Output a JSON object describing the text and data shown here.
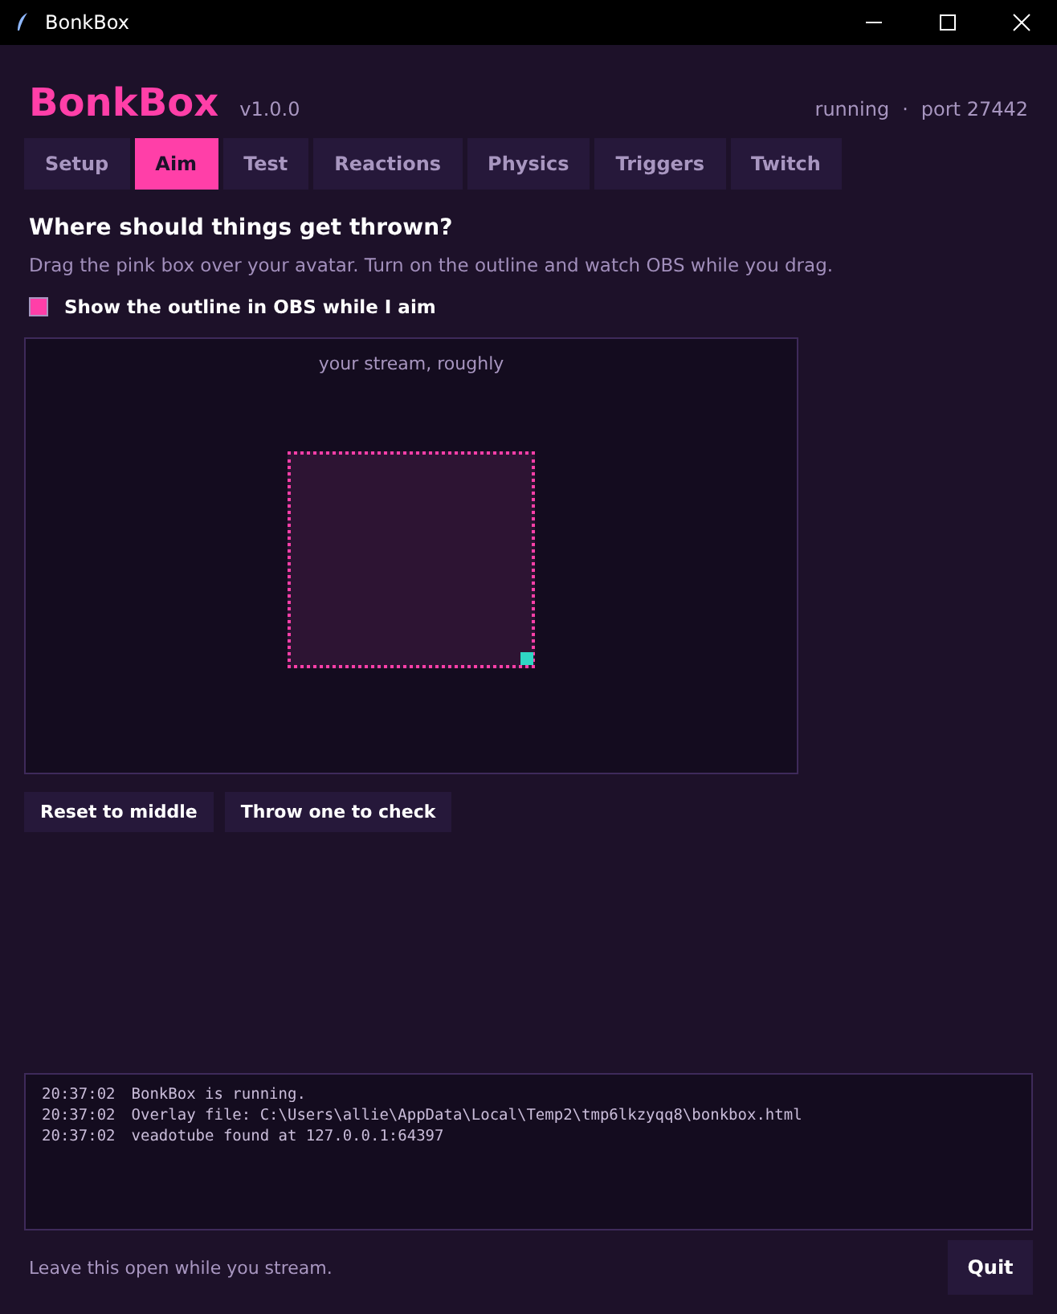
{
  "window": {
    "title": "BonkBox"
  },
  "header": {
    "app_name": "BonkBox",
    "version": "v1.0.0",
    "status": "running",
    "separator": "·",
    "port": "port 27442"
  },
  "tabs": [
    {
      "label": "Setup",
      "selected": false
    },
    {
      "label": "Aim",
      "selected": true
    },
    {
      "label": "Test",
      "selected": false
    },
    {
      "label": "Reactions",
      "selected": false
    },
    {
      "label": "Physics",
      "selected": false
    },
    {
      "label": "Triggers",
      "selected": false
    },
    {
      "label": "Twitch",
      "selected": false
    }
  ],
  "aim": {
    "heading": "Where should things get thrown?",
    "description": "Drag the pink box over your avatar. Turn on the outline and watch OBS while you drag.",
    "outline_checkbox": {
      "label": "Show the outline in OBS while I aim",
      "checked": true
    },
    "canvas_label": "your stream, roughly",
    "buttons": [
      "Reset to middle",
      "Throw one to check"
    ]
  },
  "log": [
    {
      "time": "20:37:02",
      "message": "BonkBox is running."
    },
    {
      "time": "20:37:02",
      "message": "Overlay file: C:\\Users\\allie\\AppData\\Local\\Temp2\\tmp6lkzyqq8\\bonkbox.html"
    },
    {
      "time": "20:37:02",
      "message": "veadotube found at 127.0.0.1:64397"
    }
  ],
  "footer": {
    "hint": "Leave this open while you stream.",
    "quit_button": "Quit"
  }
}
